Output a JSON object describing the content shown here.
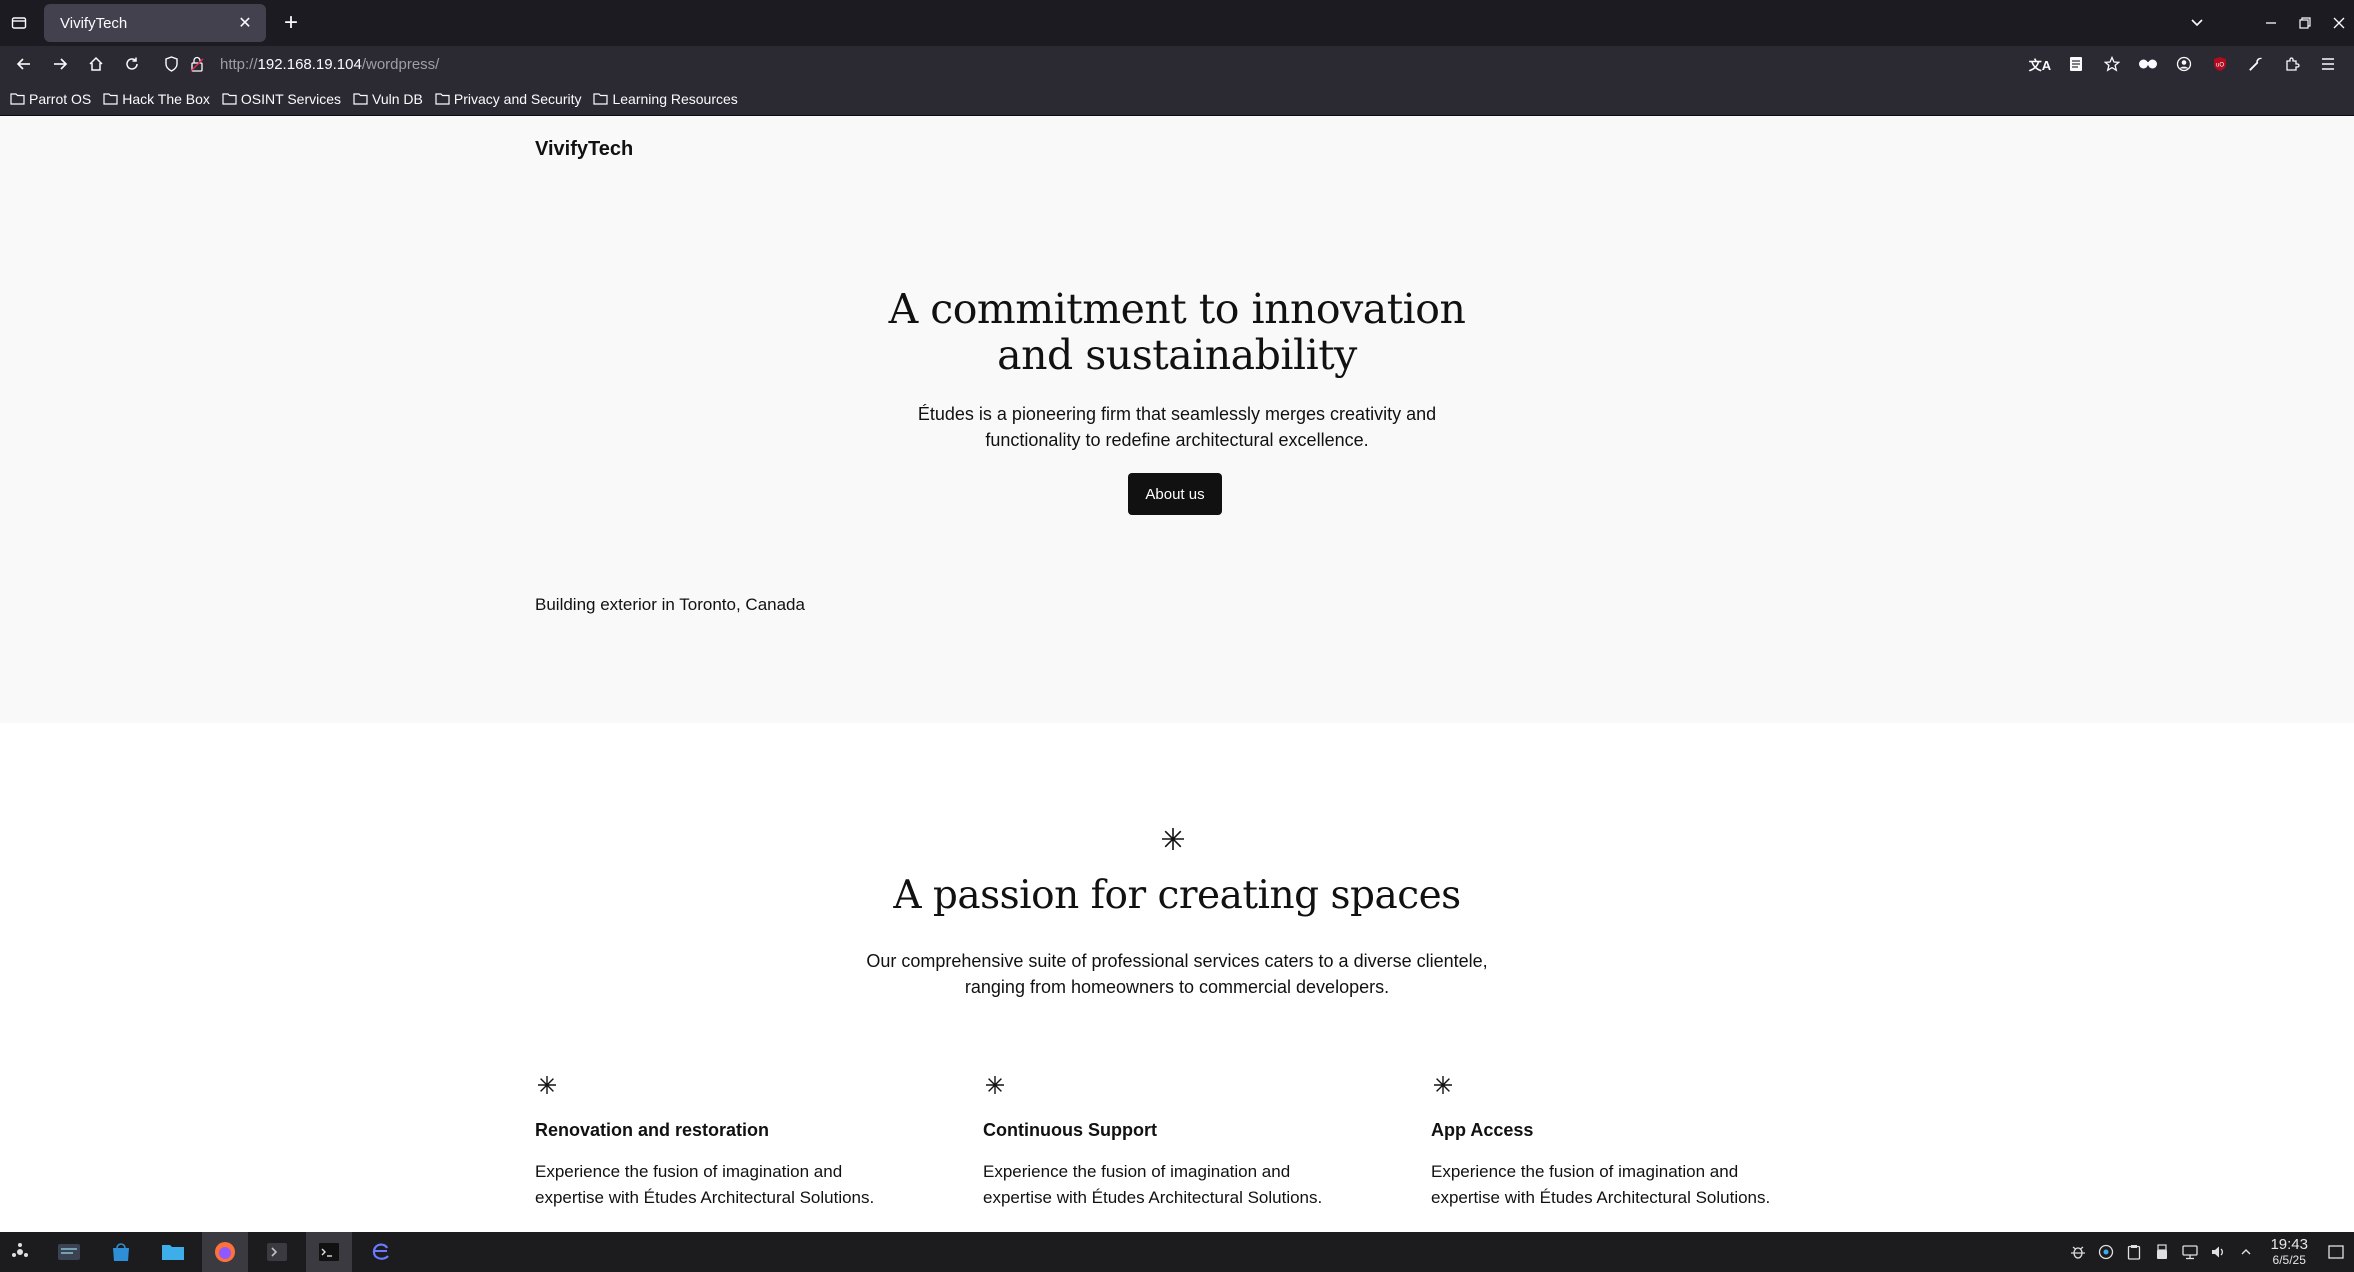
{
  "browser": {
    "tab": {
      "title": "VivifyTech"
    },
    "url": {
      "scheme": "http://",
      "host": "192.168.19.104",
      "path": "/wordpress/"
    },
    "bookmarks": [
      "Parrot OS",
      "Hack The Box",
      "OSINT Services",
      "Vuln DB",
      "Privacy and Security",
      "Learning Resources"
    ]
  },
  "page": {
    "site_title": "VivifyTech",
    "hero": {
      "heading_line1": "A commitment to innovation",
      "heading_line2": "and sustainability",
      "text_line1": "Études is a pioneering firm that seamlessly merges creativity and",
      "text_line2": "functionality to redefine architectural excellence.",
      "button": "About us",
      "caption": "Building exterior in Toronto, Canada"
    },
    "services": {
      "heading": "A passion for creating spaces",
      "text_line1": "Our comprehensive suite of professional services caters to a diverse clientele,",
      "text_line2": "ranging from homeowners to commercial developers.",
      "columns": [
        {
          "title": "Renovation and restoration",
          "text_line1": "Experience the fusion of imagination and",
          "text_line2": "expertise with Études Architectural Solutions."
        },
        {
          "title": "Continuous Support",
          "text_line1": "Experience the fusion of imagination and",
          "text_line2": "expertise with Études Architectural Solutions."
        },
        {
          "title": "App Access",
          "text_line1": "Experience the fusion of imagination and",
          "text_line2": "expertise with Études Architectural Solutions."
        }
      ]
    }
  },
  "taskbar": {
    "clock": {
      "time": "19:43",
      "date": "6/5/25"
    }
  },
  "icons": {
    "tab_list": "tab-list-icon",
    "close": "close-icon",
    "new_tab": "plus-icon",
    "back": "back-arrow-icon",
    "forward": "forward-arrow-icon",
    "home": "home-icon",
    "reload": "reload-icon",
    "bookmark_folder": "folder-icon",
    "asterisk": "asterisk-icon"
  },
  "colors": {
    "tab_bg": "#42414d",
    "toolbar_bg": "#2b2a33",
    "hero_bg": "#f9f9f9",
    "button_bg": "#111111"
  }
}
